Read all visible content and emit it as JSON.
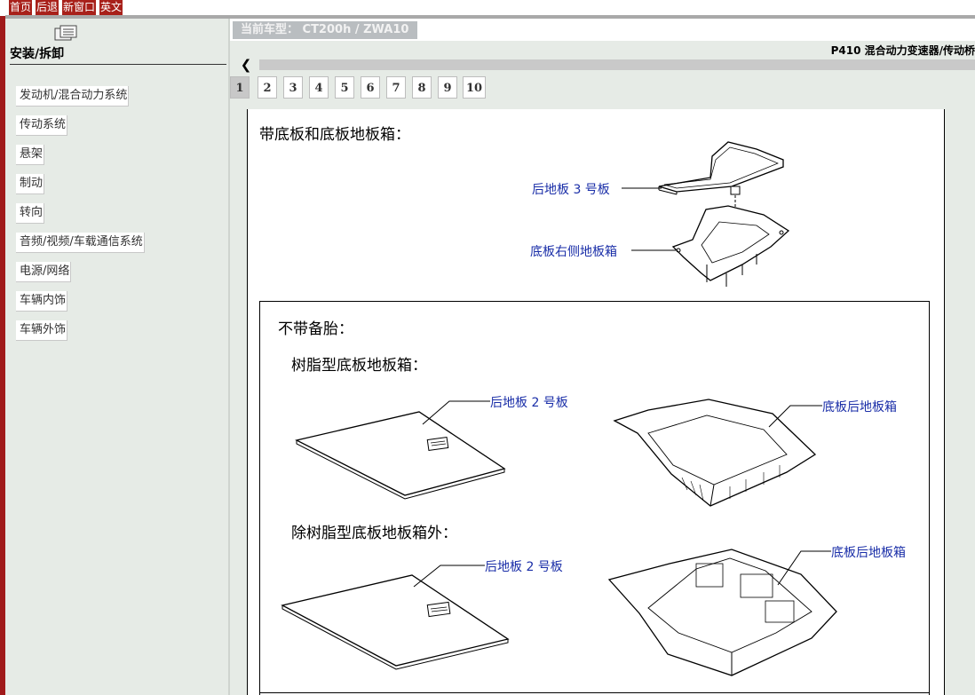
{
  "toolbar": {
    "home": "首页",
    "back": "后退",
    "new_window": "新窗口",
    "english": "英文"
  },
  "sidebar": {
    "title": "安装/拆卸",
    "items": [
      {
        "label": "发动机/混合动力系统"
      },
      {
        "label": "传动系统"
      },
      {
        "label": "悬架"
      },
      {
        "label": "制动"
      },
      {
        "label": "转向"
      },
      {
        "label": "音频/视频/车载通信系统"
      },
      {
        "label": "电源/网络"
      },
      {
        "label": "车辆内饰"
      },
      {
        "label": "车辆外饰"
      }
    ]
  },
  "model": {
    "label": "当前车型： CT200h / ZWA10"
  },
  "section_title": "P410 混合动力变速器/传动桥",
  "pager": {
    "pages": [
      "1",
      "2",
      "3",
      "4",
      "5",
      "6",
      "7",
      "8",
      "9",
      "10"
    ],
    "current": "1"
  },
  "document": {
    "caption_with_floor": "带底板和底板地板箱：",
    "label_rear_floor_3": "后地板 3 号板",
    "label_floor_right_box": "底板右侧地板箱",
    "caption_no_spare": "不带备胎：",
    "caption_resin": "树脂型底板地板箱：",
    "label_rear_floor_2_a": "后地板 2 号板",
    "label_floor_rear_box_a": "底板后地板箱",
    "caption_non_resin": "除树脂型底板地板箱外：",
    "label_rear_floor_2_b": "后地板 2 号板",
    "label_floor_rear_box_b": "底板后地板箱"
  }
}
